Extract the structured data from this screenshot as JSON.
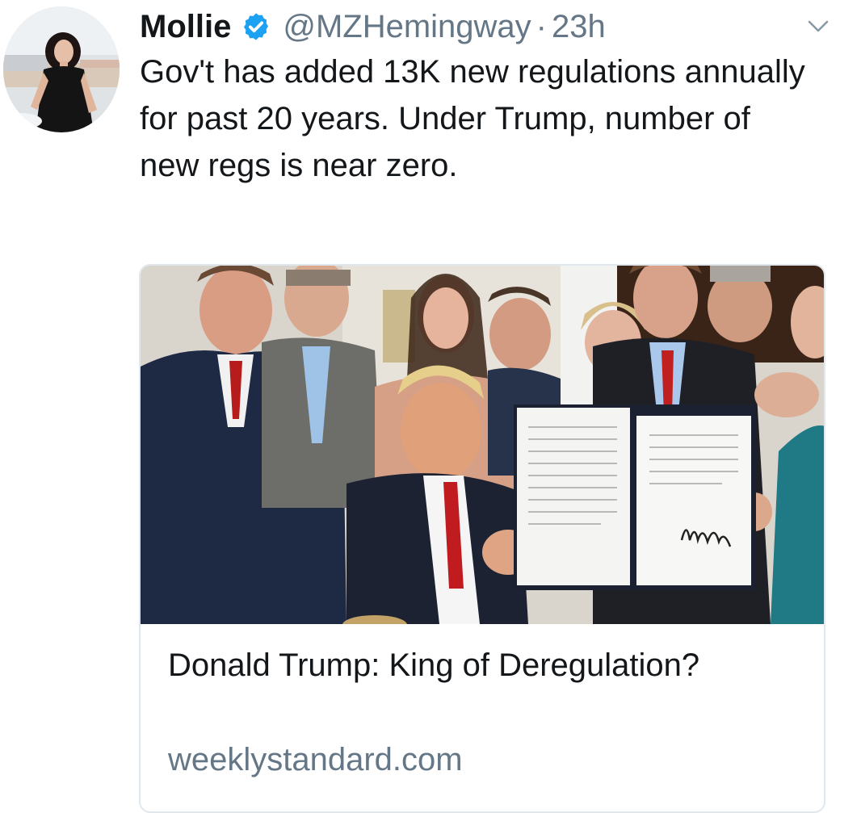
{
  "tweet": {
    "author": {
      "name": "Mollie",
      "handle": "@MZHemingway",
      "verified": true,
      "avatar_icon": "profile-photo"
    },
    "separator": "·",
    "time": "23h",
    "text": "Gov't has added 13K new regulations annually for past 20 years. Under Trump, number of new regs is near zero.",
    "menu_icon": "chevron-down-icon",
    "card": {
      "image_icon": "photo-signing-ceremony",
      "signature_text": "Donald Trump",
      "title": "Donald Trump: King of Deregulation?",
      "domain": "weeklystandard.com"
    }
  },
  "colors": {
    "text_primary": "#14171a",
    "text_secondary": "#657786",
    "verified_blue": "#1da1f2",
    "card_border": "#e1e8ed"
  }
}
